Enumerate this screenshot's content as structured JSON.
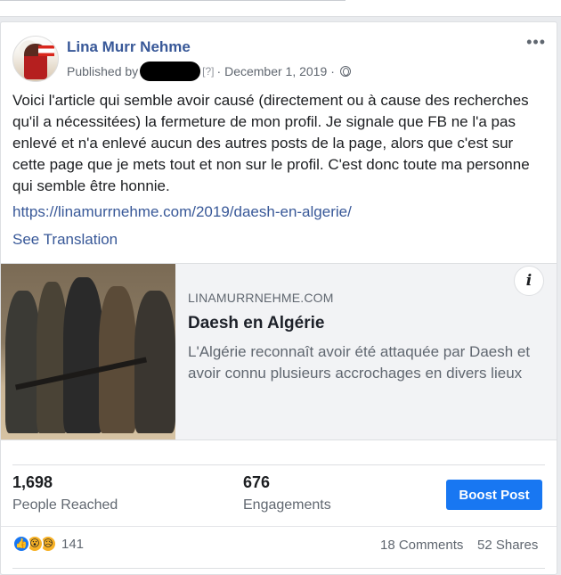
{
  "post": {
    "page_name": "Lina Murr Nehme",
    "published_prefix": "Published by",
    "help_mark": "[?]",
    "separator": "·",
    "date": "December 1, 2019",
    "text": "Voici l'article qui semble avoir causé (directement ou à cause des recherches qu'il a nécessitées) la fermeture de mon profil. Je signale que FB ne l'a pas enlevé et n'a enlevé aucun des autres posts de la page, alors que c'est sur cette page que je mets tout et non sur le profil. C'est donc toute ma personne qui semble être honnie.",
    "link": "https://linamurrnehme.com/2019/daesh-en-algerie/",
    "see_translation": "See Translation",
    "more_label": "•••",
    "icons": {
      "more": "more-options-icon",
      "globe": "globe-icon",
      "info": "info-icon"
    }
  },
  "preview": {
    "domain": "LINAMURRNEHME.COM",
    "title": "Daesh en Algérie",
    "description": "L'Algérie reconnaît avoir été attaquée par Daesh et avoir connu plusieurs accrochages en divers lieux",
    "info_glyph": "i"
  },
  "stats": {
    "reached_value": "1,698",
    "reached_label": "People Reached",
    "engagements_value": "676",
    "engagements_label": "Engagements",
    "boost_label": "Boost Post"
  },
  "reactions": {
    "count": "141",
    "comments": "18 Comments",
    "shares": "52 Shares",
    "types": [
      "like",
      "wow",
      "sad"
    ]
  },
  "colors": {
    "link": "#385898",
    "boost": "#1877f2",
    "muted": "#606770"
  }
}
